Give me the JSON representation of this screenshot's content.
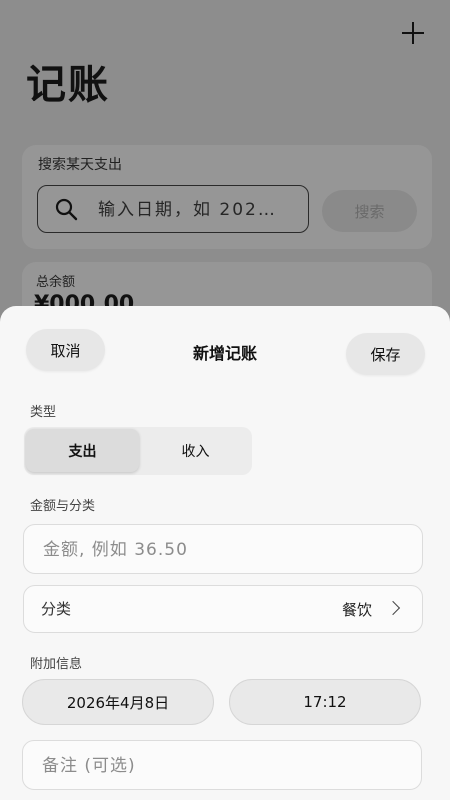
{
  "background": {
    "title": "记账",
    "search_card": {
      "title": "搜索某天支出",
      "placeholder": "输入日期，如 202…",
      "search_label": "搜索"
    },
    "balance_card": {
      "label": "总余额",
      "value": "¥000.00"
    }
  },
  "sheet": {
    "cancel_label": "取消",
    "title": "新增记账",
    "save_label": "保存",
    "type_section_label": "类型",
    "type_options": [
      "支出",
      "收入"
    ],
    "selected_type": "支出",
    "amount_section_label": "金额与分类",
    "amount_placeholder": "金额, 例如 36.50",
    "category_label": "分类",
    "category_value": "餐饮",
    "extra_section_label": "附加信息",
    "date": "2026年4月8日",
    "time": "17:12",
    "note_placeholder": "备注 (可选)"
  },
  "colors": {
    "overlay": "#8d8d8d",
    "sheet_bg": "#f7f7f7",
    "button_bg": "#e7e7e7"
  }
}
